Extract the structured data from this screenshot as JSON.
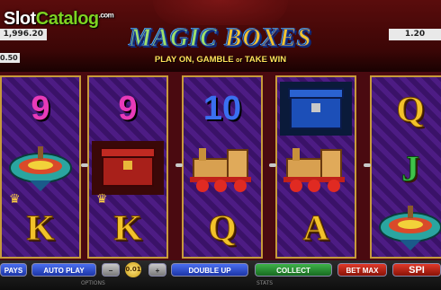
{
  "watermark": {
    "slot": "Slot",
    "catalog": "Catalog",
    "com": ".com"
  },
  "header": {
    "credit": "1,996.20",
    "bet": "1.20",
    "small_value": "0.50",
    "title_magic": "MAGIC",
    "title_boxes": "BOXES",
    "tagline_a": "PLAY ON, GAMBLE",
    "tagline_or": "or",
    "tagline_b": "TAKE WIN"
  },
  "reels": [
    {
      "symbols": [
        {
          "type": "number",
          "label": "9",
          "color": "#e83ab8"
        },
        {
          "type": "top",
          "label": ""
        },
        {
          "type": "letter",
          "label": "K"
        }
      ]
    },
    {
      "symbols": [
        {
          "type": "number",
          "label": "9",
          "color": "#e83ab8"
        },
        {
          "type": "box",
          "label": ""
        },
        {
          "type": "letter",
          "label": "K"
        }
      ]
    },
    {
      "symbols": [
        {
          "type": "number",
          "label": "10",
          "color": "#3a6ff0"
        },
        {
          "type": "train",
          "label": ""
        },
        {
          "type": "letter",
          "label": "Q"
        }
      ]
    },
    {
      "symbols": [
        {
          "type": "bluebox",
          "label": ""
        },
        {
          "type": "train",
          "label": ""
        },
        {
          "type": "letter",
          "label": "A"
        }
      ]
    },
    {
      "symbols": [
        {
          "type": "letter",
          "label": "Q"
        },
        {
          "type": "letter",
          "label": "J",
          "color": "#3fc24a"
        },
        {
          "type": "top",
          "label": ""
        }
      ]
    }
  ],
  "controls": {
    "pays": "PAYS",
    "auto_play": "AUTO PLAY",
    "coin_value": "0.01",
    "minus": "−",
    "plus": "+",
    "double_up": "DOUBLE UP",
    "collect": "COLLECT",
    "bet_max": "BET MAX",
    "spin": "SPI"
  },
  "footer": {
    "options": "OPTIONS",
    "stats": "STATS"
  },
  "colors": {
    "accent": "#c79a3a",
    "reel_bg": "#3a1268"
  }
}
